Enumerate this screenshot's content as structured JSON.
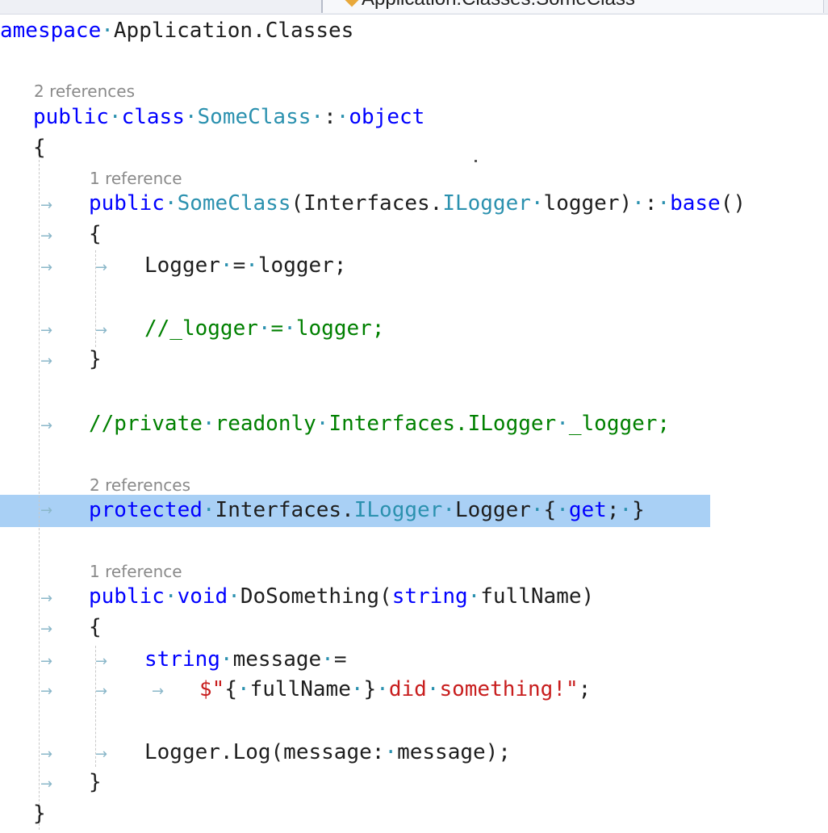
{
  "nav": {
    "member_dropdown": "Application.Classes.SomeClass"
  },
  "codelens": {
    "class_refs": "2 references",
    "ctor_refs": "1 reference",
    "logger_prop_refs": "2 references",
    "method_refs": "1 reference"
  },
  "code": {
    "l1": {
      "t1": "amespace",
      "d1": "·",
      "t2": "Application.Classes"
    },
    "l2": {
      "k1": "public",
      "d1": "·",
      "k2": "class",
      "d2": "·",
      "t1": "SomeClass",
      "d3": "·",
      "p1": ":",
      "d4": "·",
      "k3": "object"
    },
    "l3": {
      "p1": "{"
    },
    "l4": {
      "k1": "public",
      "d1": "·",
      "t1": "SomeClass",
      "p1": "(Interfaces.",
      "t2": "ILogger",
      "d2": "·",
      "p2": "logger)",
      "d3": "·",
      "p3": ":",
      "d4": "·",
      "k2": "base",
      "p4": "()"
    },
    "l5": {
      "p1": "{"
    },
    "l6": {
      "p1": "Logger",
      "d1": "·",
      "p2": "=",
      "d2": "·",
      "p3": "logger;"
    },
    "l7": {
      "c1": "//_logger",
      "d1": "·",
      "c2": "=",
      "d2": "·",
      "c3": "logger;"
    },
    "l8": {
      "p1": "}"
    },
    "l9": {
      "c1": "//private",
      "d1": "·",
      "c2": "readonly",
      "d2": "·",
      "c3": "Interfaces.ILogger",
      "d3": "·",
      "c4": "_logger;"
    },
    "l10": {
      "k1": "protected",
      "d1": "·",
      "p1": "Interfaces.",
      "t1": "ILogger",
      "d2": "·",
      "p2": "Logger",
      "d3": "·",
      "p3": "{",
      "d4": "·",
      "k2": "get",
      "p4": ";",
      "d5": "·",
      "p5": "}"
    },
    "l11": {
      "k1": "public",
      "d1": "·",
      "k2": "void",
      "d2": "·",
      "p1": "DoSomething(",
      "k3": "string",
      "d3": "·",
      "p2": "fullName)"
    },
    "l12": {
      "p1": "{"
    },
    "l13": {
      "k1": "string",
      "d1": "·",
      "p1": "message",
      "d2": "·",
      "p2": "="
    },
    "l14": {
      "s1": "$\"",
      "p1": "{",
      "d1": "·",
      "p2": "fullName",
      "d2": "·",
      "p3": "}",
      "d3": "·",
      "s2": "did",
      "d4": "·",
      "s3": "something!\"",
      "p4": ";"
    },
    "l15": {
      "p1": "Logger.Log(message:",
      "d1": "·",
      "p2": "message);"
    },
    "l16": {
      "p1": "}"
    },
    "l17": {
      "p1": "}"
    }
  },
  "glyphs": {
    "tab_arrow": "→"
  }
}
